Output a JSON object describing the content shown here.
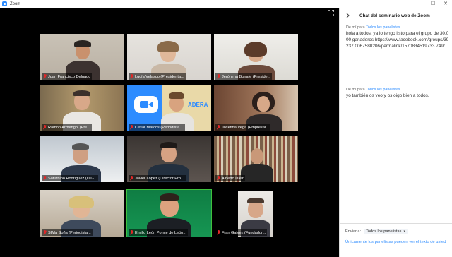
{
  "window": {
    "title": "Zoom",
    "controls": [
      "—",
      "☐",
      "✕"
    ]
  },
  "colors": {
    "accent": "#2d8cff",
    "muted": "#e02828",
    "active_speaker": "#3ec13e"
  },
  "participants": [
    {
      "name": "Juan Francisco Delgado",
      "muted": true
    },
    {
      "name": "Lucía Velasco (Presidenta...",
      "muted": true
    },
    {
      "name": "Jerónima Bonafe (Preside...",
      "muted": true
    },
    {
      "name": "Ramón Armengol (Pte...",
      "muted": true
    },
    {
      "name": "César Marcos (Periodista ...",
      "muted": true
    },
    {
      "name": "Josefina Vega (Empresar...",
      "muted": true
    },
    {
      "name": "Saturnino Rodríguez (D.G...",
      "muted": true
    },
    {
      "name": "Javier López (Director Pro...",
      "muted": true
    },
    {
      "name": "Alberto Díez",
      "muted": true
    },
    {
      "name": "SIMa Soña (Periodista...",
      "muted": true
    },
    {
      "name": "Emilio León Ponce de León...",
      "muted": true,
      "active": true
    },
    {
      "name": "Fran Galvez (Fundador...",
      "muted": true
    }
  ],
  "chat": {
    "title": "Chat del seminario web de Zoom",
    "messages": [
      {
        "from": "De mí para",
        "to": "Todos los panelistas",
        "text": "hola a todos, ya lo tengo listo para el grupo de 30.000 ganaderos https://www.facebook.com/groups/39237 0067580206/permalink/1570834519733 749/"
      },
      {
        "from": "De mí para",
        "to": "Todos los panelistas",
        "text": "yo también os veo y os oigo bien a todos."
      }
    ],
    "send_to_label": "Enviar a:",
    "send_to_value": "Todos los panelistas",
    "note": "Únicamente los panelistas pueden ver el texto de usted"
  }
}
